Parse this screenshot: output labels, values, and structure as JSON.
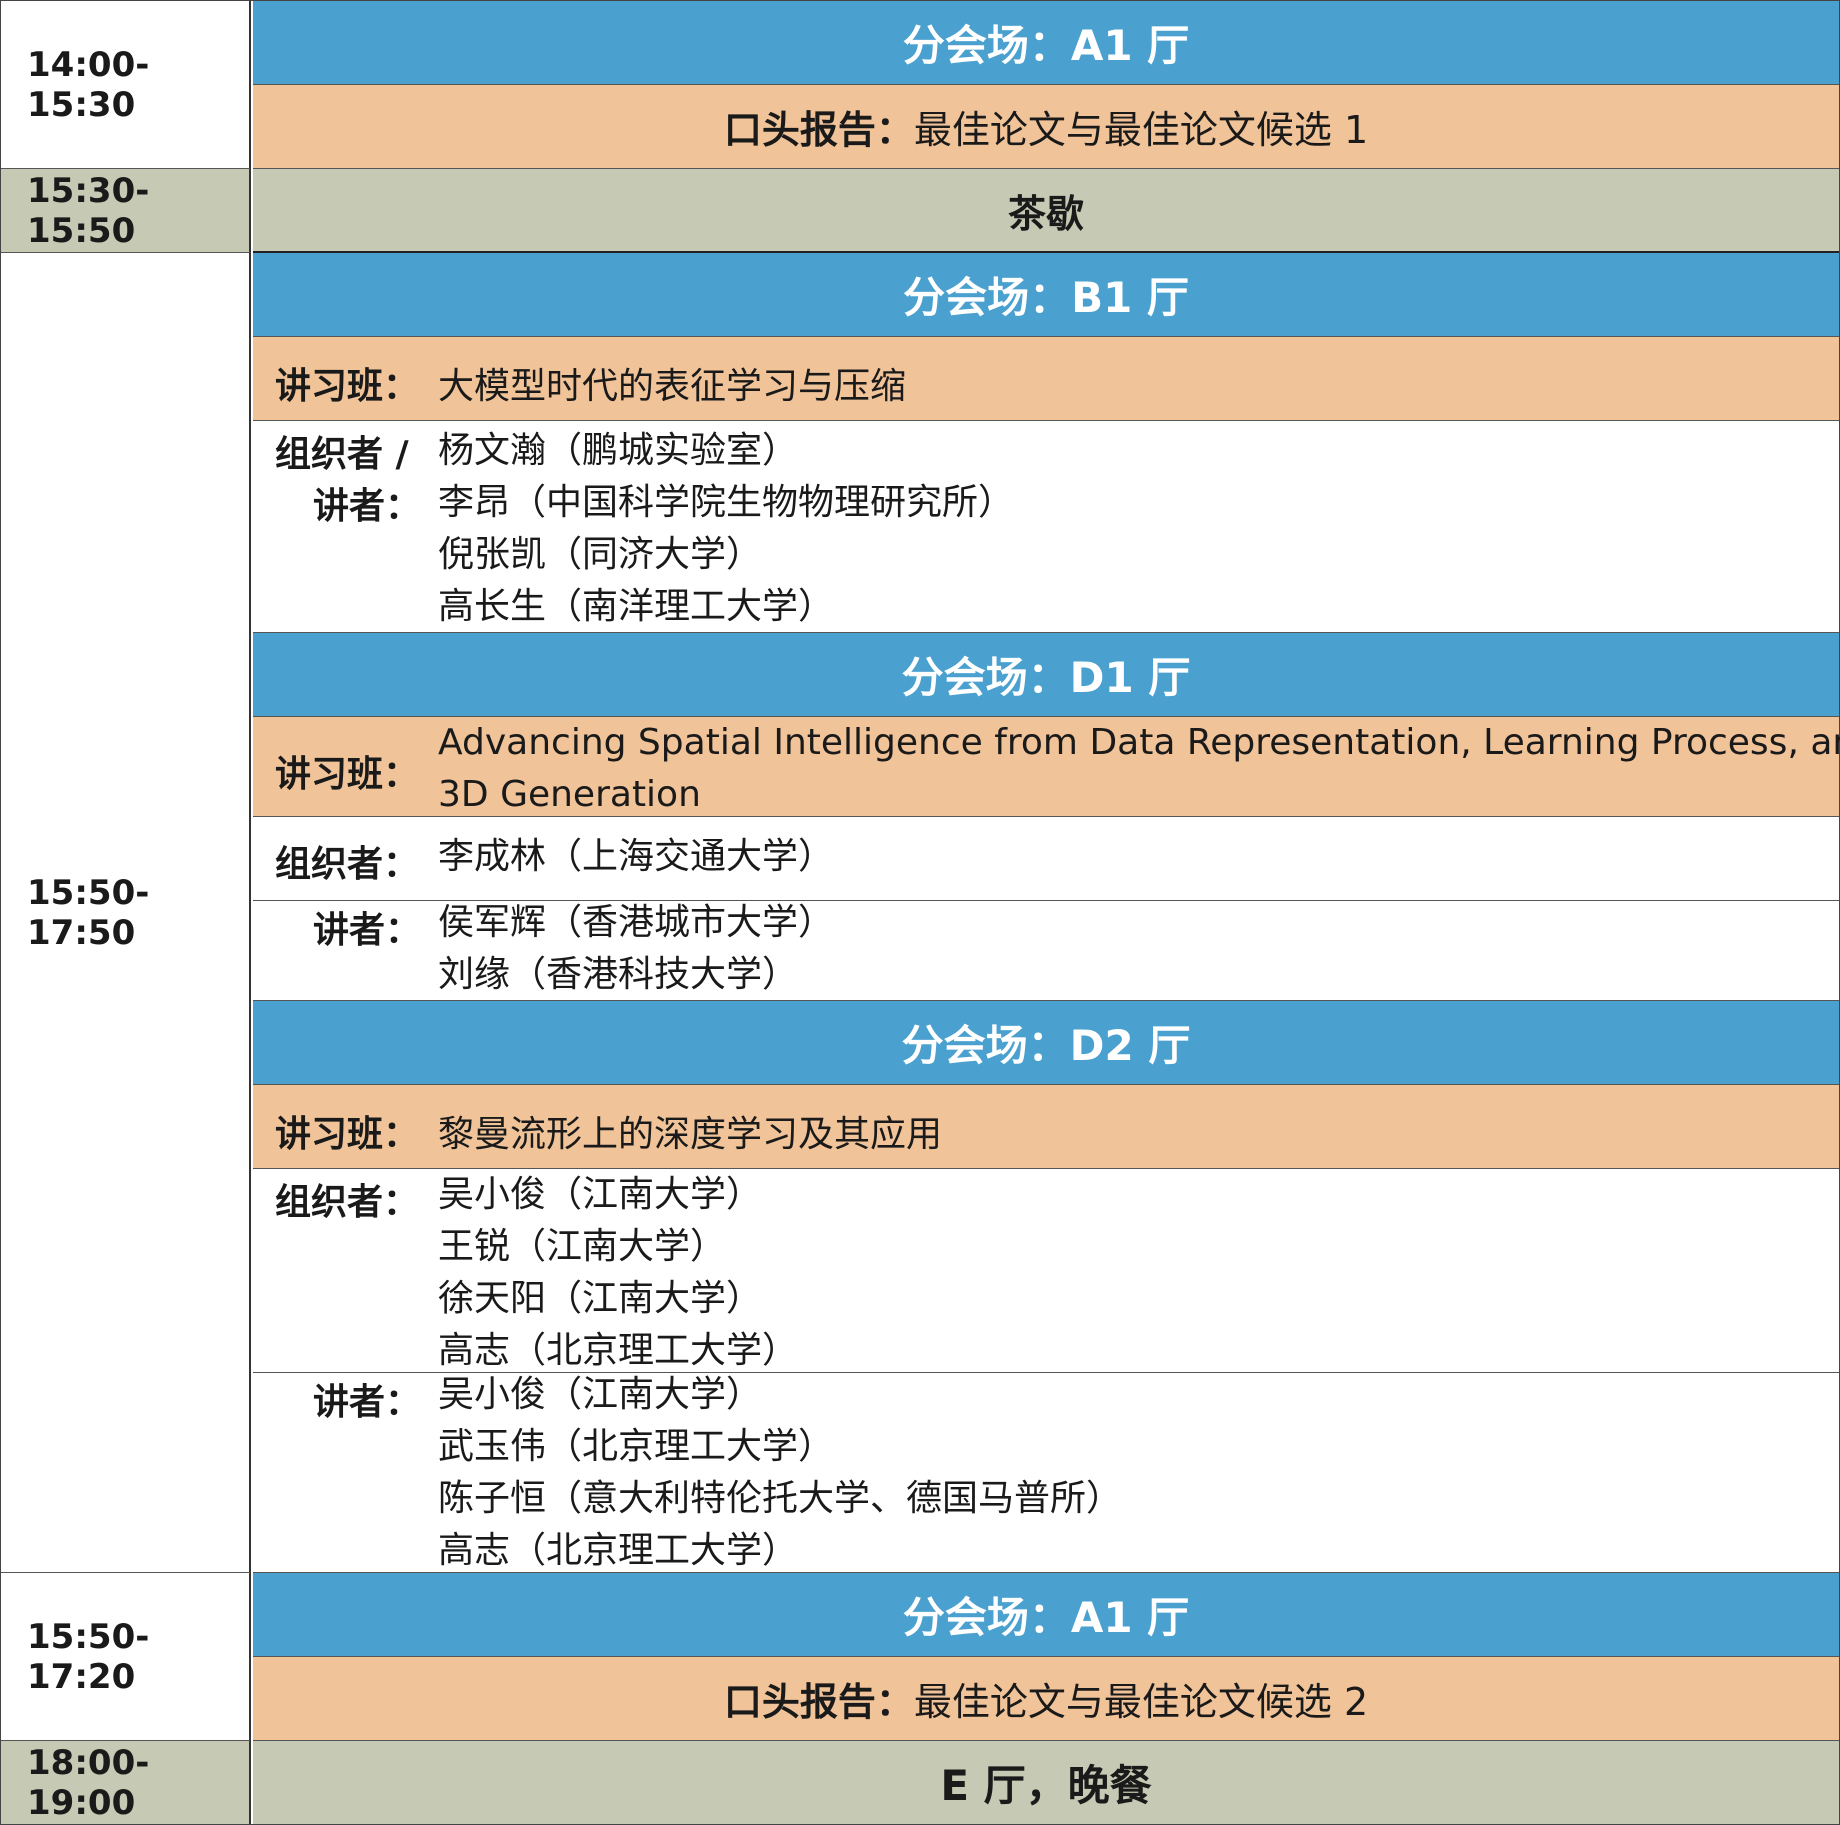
{
  "times": [
    "14:00-15:30",
    "15:30-15:50",
    "15:50-17:50",
    "15:50-17:20",
    "18:00-19:00"
  ],
  "block1": {
    "venue": "分会场：A1 厅",
    "oral_label": "口头报告：",
    "oral_title": "最佳论文与最佳论文候选 1"
  },
  "break": {
    "label": "茶歇"
  },
  "b1": {
    "venue": "分会场：B1 厅",
    "workshop_label": "讲习班：",
    "workshop_title": "大模型时代的表征学习与压缩",
    "org_label_1": "组织者 /",
    "org_label_2": "讲者：",
    "people": [
      "杨文瀚（鹏城实验室）",
      "李昂（中国科学院生物物理研究所）",
      "倪张凯（同济大学）",
      "高长生（南洋理工大学）"
    ]
  },
  "d1": {
    "venue": "分会场：D1 厅",
    "workshop_label": "讲习班：",
    "workshop_title_1": "Advancing Spatial Intelligence from Data Representation, Learning Process, and",
    "workshop_title_2": "3D Generation",
    "org_label": "组织者：",
    "organizers": [
      "李成林（上海交通大学）"
    ],
    "speaker_label": "讲者：",
    "speakers": [
      "侯军辉（香港城市大学）",
      "刘缘（香港科技大学）"
    ]
  },
  "d2": {
    "venue": "分会场：D2 厅",
    "workshop_label": "讲习班：",
    "workshop_title": "黎曼流形上的深度学习及其应用",
    "org_label": "组织者：",
    "organizers": [
      "吴小俊（江南大学）",
      "王锐（江南大学）",
      "徐天阳（江南大学）",
      "高志（北京理工大学）"
    ],
    "speaker_label": "讲者：",
    "speakers": [
      "吴小俊（江南大学）",
      "武玉伟（北京理工大学）",
      "陈子恒（意大利特伦托大学、德国马普所）",
      "高志（北京理工大学）"
    ]
  },
  "block4": {
    "venue": "分会场：A1 厅",
    "oral_label": "口头报告：",
    "oral_title": "最佳论文与最佳论文候选 2"
  },
  "dinner": {
    "label": "E 厅，晚餐"
  },
  "colors": {
    "blue": "#4aa0cf",
    "orange": "#f0c399",
    "gray": "#c6c9b3"
  }
}
